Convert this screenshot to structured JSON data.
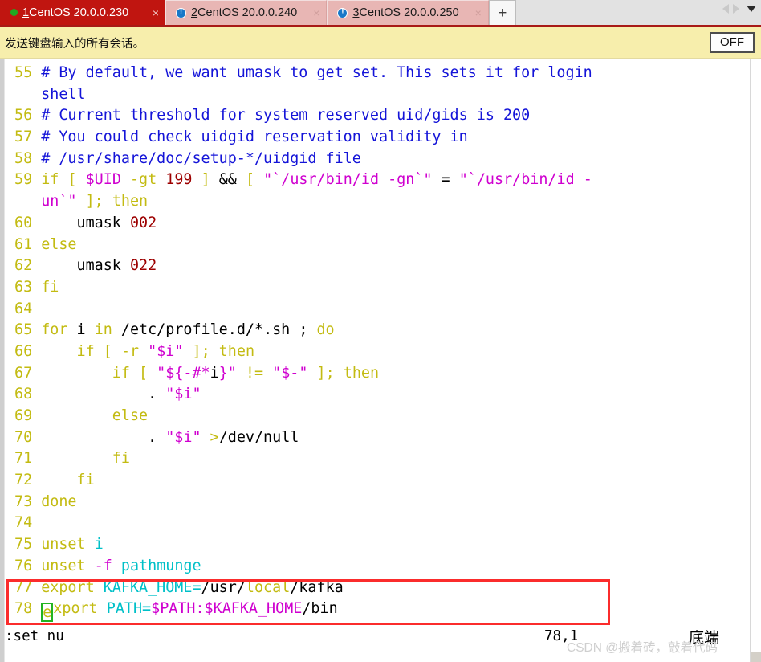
{
  "tabbar": {
    "tabs": [
      {
        "num": "1",
        "title": " CentOS 20.0.0.230",
        "icon": "green-status-dot",
        "close": "×",
        "active": true
      },
      {
        "num": "2",
        "title": " CentOS 20.0.0.240",
        "icon": "blue-alert-icon",
        "close": "×",
        "active": false
      },
      {
        "num": "3",
        "title": " CentOS 20.0.0.250",
        "icon": "blue-alert-icon",
        "close": "×",
        "active": false
      }
    ],
    "new_tab_label": "+",
    "nav_prev_icon": "triangle-left-icon",
    "nav_next_icon": "triangle-right-icon",
    "nav_menu_icon": "chevron-down-icon",
    "active_bg": "#c01510",
    "inactive_bg": "#e8b6b4"
  },
  "notice": {
    "text": "发送键盘输入的所有会话。",
    "toggle_label": "OFF",
    "bg": "#f7eeac"
  },
  "editor": {
    "lines": [
      {
        "n": "55",
        "text": "# By default, we want umask to get set. This sets it for login"
      },
      {
        "n": "",
        "text": "  shell"
      },
      {
        "n": "56",
        "text": "# Current threshold for system reserved uid/gids is 200"
      },
      {
        "n": "57",
        "text": "# You could check uidgid reservation validity in"
      },
      {
        "n": "58",
        "text": "# /usr/share/doc/setup-*/uidgid file"
      },
      {
        "n": "59",
        "text": "if [ $UID -gt 199 ] && [ \"`/usr/bin/id -gn`\" = \"`/usr/bin/id -"
      },
      {
        "n": "",
        "text": "un`\" ]; then"
      },
      {
        "n": "60",
        "text": "    umask 002"
      },
      {
        "n": "61",
        "text": "else"
      },
      {
        "n": "62",
        "text": "    umask 022"
      },
      {
        "n": "63",
        "text": "fi"
      },
      {
        "n": "64",
        "text": ""
      },
      {
        "n": "65",
        "text": "for i in /etc/profile.d/*.sh ; do"
      },
      {
        "n": "66",
        "text": "    if [ -r \"$i\" ]; then"
      },
      {
        "n": "67",
        "text": "        if [ \"${-#*i}\" != \"$-\" ]; then"
      },
      {
        "n": "68",
        "text": "            . \"$i\""
      },
      {
        "n": "69",
        "text": "        else"
      },
      {
        "n": "70",
        "text": "            . \"$i\" >/dev/null"
      },
      {
        "n": "71",
        "text": "        fi"
      },
      {
        "n": "72",
        "text": "    fi"
      },
      {
        "n": "73",
        "text": "done"
      },
      {
        "n": "74",
        "text": ""
      },
      {
        "n": "75",
        "text": "unset i"
      },
      {
        "n": "76",
        "text": "unset -f pathmunge"
      },
      {
        "n": "77",
        "text": "export KAFKA_HOME=/usr/local/kafka"
      },
      {
        "n": "78",
        "text": "export PATH=$PATH:$KAFKA_HOME/bin"
      }
    ],
    "cursor_char": "e",
    "cursor_line": "78",
    "cursor_color": "#22b422",
    "highlight_box_color": "#fb2c2c",
    "highlight_lines": [
      "77",
      "78"
    ]
  },
  "status": {
    "command": ":set nu",
    "position": "78,1",
    "file_position_label": "底端"
  },
  "watermark": {
    "text": "CSDN @搬着砖，敲着代码"
  }
}
